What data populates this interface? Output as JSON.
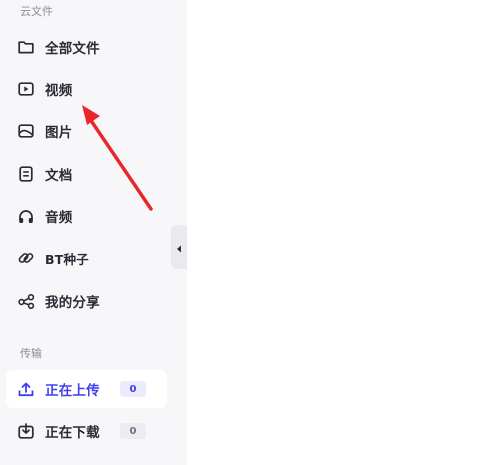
{
  "sections": {
    "cloud_files": "云文件",
    "transfer": "传输"
  },
  "nav": {
    "all_files": "全部文件",
    "videos": "视频",
    "images": "图片",
    "documents": "文档",
    "audio": "音频",
    "bt_torrents": "BT种子",
    "my_shares": "我的分享",
    "uploading": "正在上传",
    "downloading": "正在下载"
  },
  "badges": {
    "uploading_count": "0",
    "downloading_count": "0"
  },
  "colors": {
    "accent": "#3f3ff0",
    "annotation_arrow": "#e8262b",
    "sidebar_bg": "#f7f7f9"
  },
  "icons": [
    "folder-icon",
    "video-icon",
    "image-icon",
    "document-icon",
    "headphones-icon",
    "link-icon",
    "share-icon",
    "upload-icon",
    "download-icon",
    "chevron-left-icon"
  ]
}
